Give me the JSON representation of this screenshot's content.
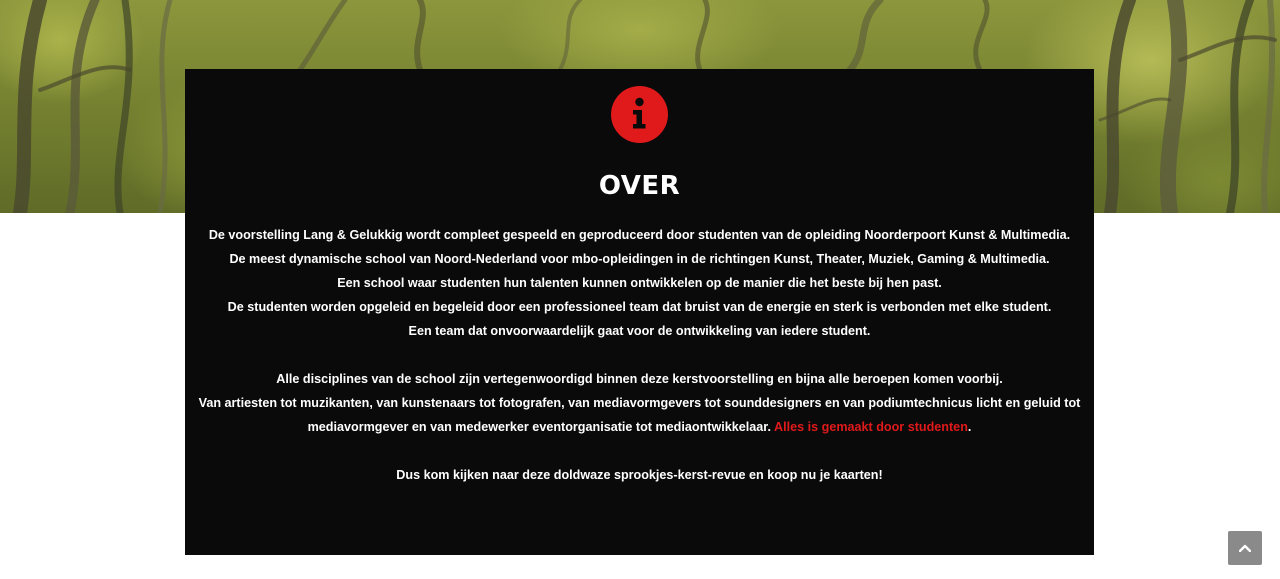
{
  "about": {
    "icon": "info-icon",
    "title": "OVER",
    "paragraph1": [
      "De voorstelling Lang & Gelukkig wordt compleet gespeeld en geproduceerd door studenten van de opleiding Noorderpoort Kunst & Multimedia.",
      "De meest dynamische school van Noord-Nederland voor mbo-opleidingen in de richtingen Kunst, Theater, Muziek, Gaming & Multimedia.",
      "Een school waar studenten hun talenten kunnen ontwikkelen op de manier die het beste bij hen past.",
      "De studenten worden opgeleid en begeleid door een professioneel team dat bruist van de energie en sterk is verbonden met elke student.",
      "Een team dat onvoorwaardelijk gaat voor de ontwikkeling van iedere student."
    ],
    "paragraph2": {
      "line1": "Alle disciplines van de school zijn vertegenwoordigd binnen deze kerstvoorstelling en bijna alle beroepen komen voorbij.",
      "line2": "Van artiesten tot muzikanten, van kunstenaars tot fotografen, van mediavormgevers tot sounddesigners en van podiumtechnicus licht en geluid tot mediavormgever en van medewerker eventorganisatie tot mediaontwikkelaar.",
      "highlight": "Alles is gemaakt door studenten",
      "end": "."
    },
    "paragraph3": "Dus kom kijken naar deze doldwaze sprookjes-kerst-revue en koop nu je kaarten!"
  },
  "scroll_top": {
    "icon": "chevron-up-icon"
  },
  "colors": {
    "accent": "#e0191b",
    "card_background": "#0a0a0a",
    "scroll_button": "#8a8a8a"
  }
}
